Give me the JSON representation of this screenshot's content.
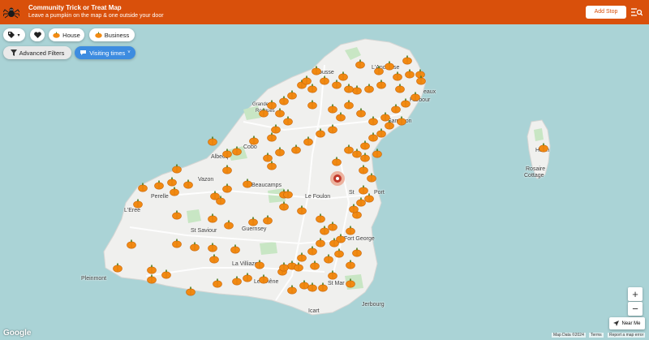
{
  "header": {
    "title": "Community Trick or Treat Map",
    "subtitle": "Leave a pumpkin on the map & one outside your door",
    "add_stop_label": "Add Stop"
  },
  "filters": {
    "house_label": "House",
    "business_label": "Business",
    "tag_dropdown_caret": "▾",
    "advanced_label": "Advanced Filters",
    "visiting_label": "Visiting times"
  },
  "map": {
    "places": [
      {
        "id": "rousse",
        "text": "Rousse"
      },
      {
        "id": "ancresse",
        "text": "L'Ancresse"
      },
      {
        "id": "beaux",
        "text": "eaux"
      },
      {
        "id": "harbour",
        "text": "Harbour"
      },
      {
        "id": "grandes",
        "text": "Grandes"
      },
      {
        "id": "rocques",
        "text": "Rocques"
      },
      {
        "id": "sampson",
        "text": "Sampson"
      },
      {
        "id": "cobo",
        "text": "Cobo"
      },
      {
        "id": "albecq",
        "text": "Albecq"
      },
      {
        "id": "vazon",
        "text": "Vazon"
      },
      {
        "id": "beaucamps",
        "text": "Beaucamps"
      },
      {
        "id": "perelle",
        "text": "Perelle"
      },
      {
        "id": "lfoulon",
        "text": "Le Foulon"
      },
      {
        "id": "stpeter",
        "text": "St"
      },
      {
        "id": "port",
        "text": "Port"
      },
      {
        "id": "leree",
        "text": "L'Eree"
      },
      {
        "id": "stsaviour",
        "text": "St Saviour"
      },
      {
        "id": "guernsey",
        "text": "Guernsey"
      },
      {
        "id": "fortgeorge",
        "text": "Fort George"
      },
      {
        "id": "villiaze",
        "text": "La Villiaze"
      },
      {
        "id": "pleinmont",
        "text": "Pleinmont"
      },
      {
        "id": "lechene",
        "text": "Le Chêne"
      },
      {
        "id": "stmartin",
        "text": "St Mar"
      },
      {
        "id": "icart",
        "text": "Icart"
      },
      {
        "id": "jerbourg",
        "text": "Jerbourg"
      },
      {
        "id": "herm",
        "text": "Herm"
      },
      {
        "id": "rosaire",
        "text": "Rosaire"
      },
      {
        "id": "cottage",
        "text": "Cottage"
      }
    ],
    "zoom_in": "+",
    "zoom_out": "−",
    "near_me_label": "Near Me",
    "google_label": "Google",
    "attribution": [
      "Map Data ©2024",
      "Terms",
      "Report a map error"
    ]
  },
  "colors": {
    "brand": "#d9500b",
    "pumpkin": "#f28a12",
    "sea": "#aad3d6",
    "land": "#efefef",
    "accent": "#3d8ce0"
  }
}
